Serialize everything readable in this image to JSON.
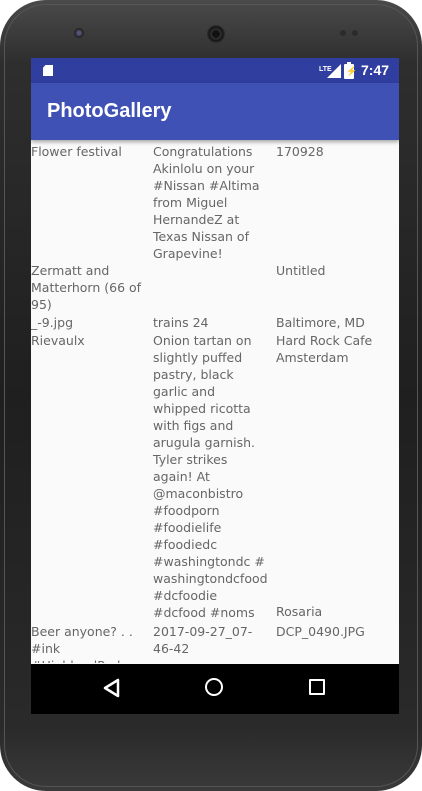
{
  "status_bar": {
    "time": "7:47",
    "network": "LTE"
  },
  "app_bar": {
    "title": "PhotoGallery"
  },
  "gallery": {
    "items": [
      "Flower festival",
      "Congratulations Akinlolu on your #Nissan #Altima from Miguel HernandeZ at Texas Nissan of Grapevine!",
      "170928",
      "Zermatt and Matterhorn (66 of 95)",
      "",
      "Untitled",
      "_-9.jpg",
      "trains 24",
      "Baltimore, MD",
      "Rievaulx",
      "Onion tartan on slightly puffed pastry, black garlic and whipped ricotta with figs and arugula garnish. Tyler strikes again! At @maconbistro #foodporn #foodielife #foodiedc #washingtondc # washingtondcfood #dcfoodie #dcfood #noms",
      "Hard Rock Cafe Amsterdam",
      "",
      "",
      "Rosaria",
      "Beer anyone? . . #ink #HighlandPark",
      "2017-09-27_07-46-42",
      "DCP_0490.JPG"
    ]
  },
  "colors": {
    "status_bar": "#303f9f",
    "app_bar": "#3f51b5",
    "background": "#fafafa",
    "text": "#666666"
  }
}
